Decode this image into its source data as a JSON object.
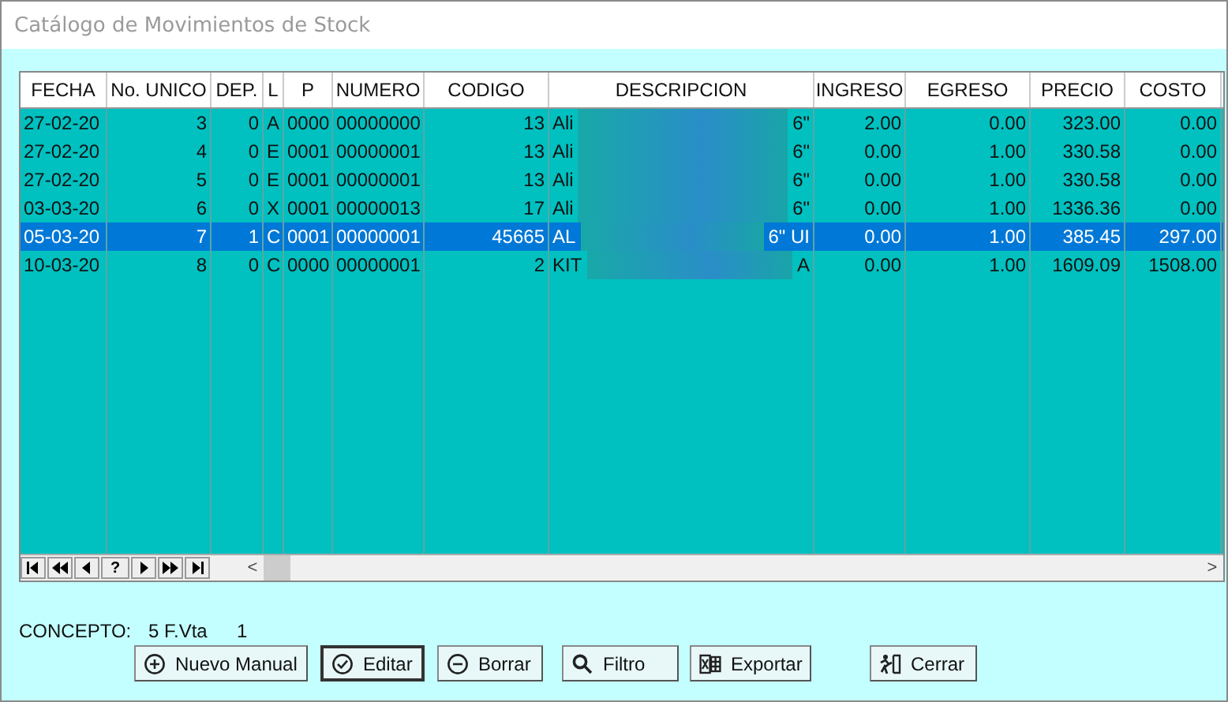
{
  "window": {
    "title": "Catálogo de Movimientos de Stock"
  },
  "table": {
    "columns": [
      {
        "label": "FECHA"
      },
      {
        "label": "No. UNICO"
      },
      {
        "label": "DEP."
      },
      {
        "label": "L"
      },
      {
        "label": "P"
      },
      {
        "label": "NUMERO"
      },
      {
        "label": "CODIGO"
      },
      {
        "label": "DESCRIPCION"
      },
      {
        "label": "INGRESO"
      },
      {
        "label": "EGRESO"
      },
      {
        "label": "PRECIO"
      },
      {
        "label": "COSTO"
      }
    ],
    "rows": [
      {
        "selected": false,
        "cells": [
          "27-02-20",
          "3",
          "0",
          "A",
          "0000",
          "00000000",
          "13",
          {
            "start": "Ali",
            "end": "6\""
          },
          "2.00",
          "0.00",
          "323.00",
          "0.00"
        ]
      },
      {
        "selected": false,
        "cells": [
          "27-02-20",
          "4",
          "0",
          "E",
          "0001",
          "00000001",
          "13",
          {
            "start": "Ali",
            "end": "6\""
          },
          "0.00",
          "1.00",
          "330.58",
          "0.00"
        ]
      },
      {
        "selected": false,
        "cells": [
          "27-02-20",
          "5",
          "0",
          "E",
          "0001",
          "00000001",
          "13",
          {
            "start": "Ali",
            "end": "6\""
          },
          "0.00",
          "1.00",
          "330.58",
          "0.00"
        ]
      },
      {
        "selected": false,
        "cells": [
          "03-03-20",
          "6",
          "0",
          "X",
          "0001",
          "00000013",
          "17",
          {
            "start": "Ali",
            "end": "6\""
          },
          "0.00",
          "1.00",
          "1336.36",
          "0.00"
        ]
      },
      {
        "selected": true,
        "cells": [
          "05-03-20",
          "7",
          "1",
          "C",
          "0001",
          "00000001",
          "45665",
          {
            "start": "AL",
            "end": "6\" UI"
          },
          "0.00",
          "1.00",
          "385.45",
          "297.00"
        ]
      },
      {
        "selected": false,
        "cells": [
          "10-03-20",
          "8",
          "0",
          "C",
          "0000",
          "00000001",
          "2",
          {
            "start": "KIT",
            "end": "A"
          },
          "0.00",
          "1.00",
          "1609.09",
          "1508.00"
        ]
      }
    ],
    "navigator": [
      {
        "kind": "first"
      },
      {
        "kind": "prior-page"
      },
      {
        "kind": "prior"
      },
      {
        "kind": "help",
        "label": "?"
      },
      {
        "kind": "next"
      },
      {
        "kind": "next-page"
      },
      {
        "kind": "last"
      }
    ],
    "scroll_left": "<",
    "scroll_right": ">"
  },
  "concepto": {
    "label": "CONCEPTO:",
    "value": "5 F.Vta",
    "extra": "1"
  },
  "buttons": [
    {
      "kind": "plus",
      "label": "Nuevo Manual",
      "focused": false
    },
    {
      "kind": "check",
      "label": "Editar",
      "focused": true
    },
    {
      "kind": "minus",
      "label": "Borrar",
      "focused": false
    },
    {
      "kind": "search",
      "label": "Filtro",
      "focused": false
    },
    {
      "kind": "excel",
      "label": "Exportar",
      "focused": false
    },
    {
      "kind": "exit",
      "label": "Cerrar",
      "focused": false
    }
  ]
}
